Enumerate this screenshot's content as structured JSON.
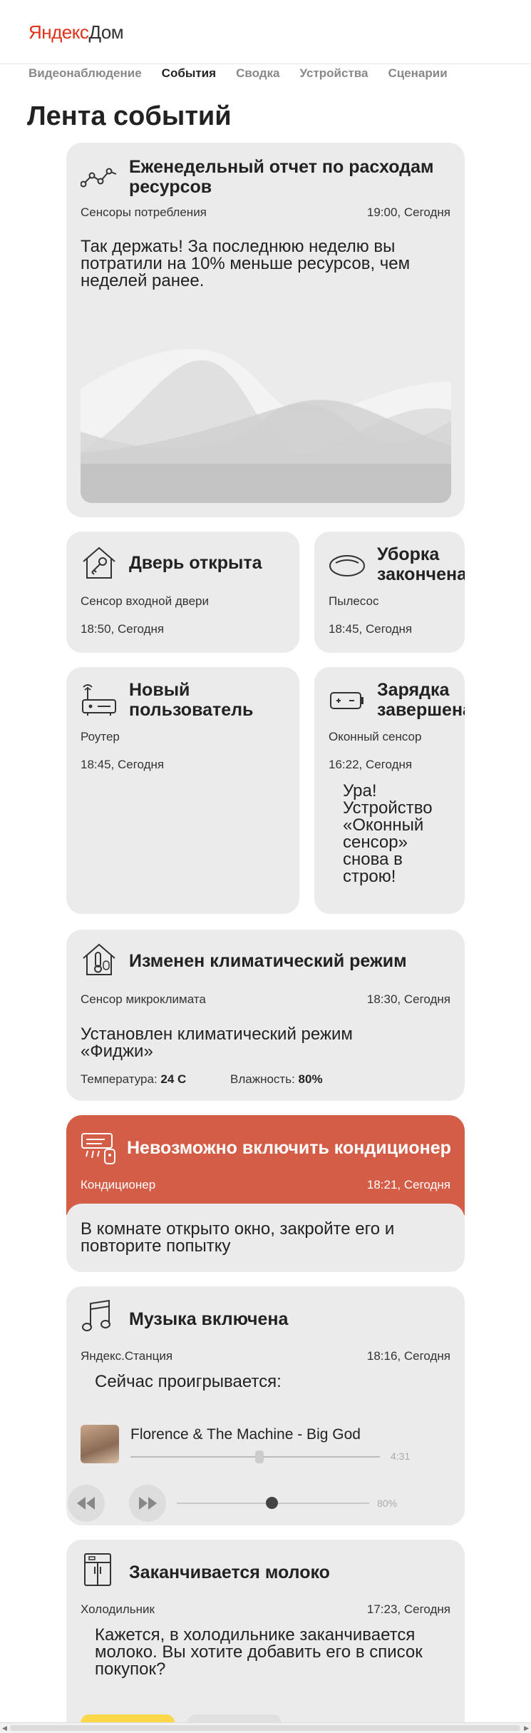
{
  "header": {
    "logo_ya": "Яндекс",
    "logo_dom": "Дом"
  },
  "nav": {
    "items": [
      {
        "label": "Видеонаблюдение"
      },
      {
        "label": "События"
      },
      {
        "label": "Сводка"
      },
      {
        "label": "Устройства"
      },
      {
        "label": "Сценарии"
      }
    ],
    "active": "События"
  },
  "page": {
    "title": "Лента событий"
  },
  "cards": {
    "report": {
      "title_1": "Еженедельный отчет по расходам",
      "title_2": "ресурсов",
      "source": "Сенсоры потребления",
      "time": "19:00, Сегодня",
      "msg_1": "Так держать! За последнюю неделю вы",
      "msg_2": "потратили на 10% меньше ресурсов, чем",
      "msg_3": "неделей ранее.",
      "icon": "line-chart-icon"
    },
    "door": {
      "title": "Дверь открыта",
      "source": "Сенсор входной двери",
      "time": "18:50, Сегодня",
      "icon": "house-key-icon"
    },
    "cleaning": {
      "title_1": "Уборка",
      "title_2": "закончена",
      "source": "Пылесос",
      "time": "18:45, Сегодня",
      "icon": "robot-vacuum-icon"
    },
    "user": {
      "title_1": "Новый",
      "title_2": "пользователь",
      "source": "Роутер",
      "time": "18:45, Сегодня",
      "icon": "router-icon"
    },
    "charging": {
      "title_1": "Зарядка",
      "title_2": "завершена",
      "source": "Оконный сенсор",
      "time": "16:22, Сегодня",
      "msg_lines": [
        "Ура!",
        "Устройство",
        "«Оконный",
        "сенсор»",
        "снова в",
        "строю!"
      ],
      "icon": "battery-icon"
    },
    "climate": {
      "title": "Изменен климатический режим",
      "source": "Сенсор микроклимата",
      "time": "18:30, Сегодня",
      "msg_1": "Установлен климатический режим",
      "msg_2": "«Фиджи»",
      "temp_label": "Температура:",
      "temp_value": "24 С",
      "hum_label": "Влажность:",
      "hum_value": "80%",
      "icon": "house-thermometer-icon"
    },
    "ac": {
      "title": "Невозможно включить кондиционер",
      "source": "Кондиционер",
      "time": "18:21, Сегодня",
      "msg_1": "В комнате открыто окно, закройте его и",
      "msg_2": "повторите попытку",
      "icon": "air-conditioner-icon",
      "accent": "#d45d47"
    },
    "music": {
      "title": "Музыка включена",
      "source": "Яндекс.Станция",
      "time": "18:16, Сегодня",
      "msg": "Сейчас проигрывается:",
      "track": "Florence & The Machine - Big God",
      "duration": "4:31",
      "progress": 0.5,
      "volume": "80%",
      "icon": "music-note-icon"
    },
    "milk": {
      "title": "Заканчивается молоко",
      "source": "Холодильник",
      "time": "17:23, Сегодня",
      "msg_1": "Кажется, в холодильнике заканчивается",
      "msg_2": "молоко. Вы хотите добавить его в список",
      "msg_3": "покупок?",
      "icon": "fridge-icon",
      "confirm_color": "#fcd74a"
    }
  }
}
